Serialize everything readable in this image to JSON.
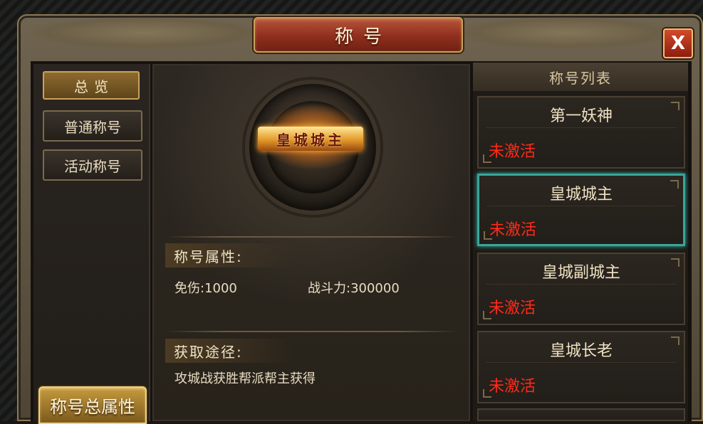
{
  "window": {
    "title": "称号",
    "close_label": "X"
  },
  "nav": {
    "items": [
      {
        "label": "总览",
        "active": true
      },
      {
        "label": "普通称号",
        "active": false
      },
      {
        "label": "活动称号",
        "active": false
      }
    ],
    "total_button": "称号总属性"
  },
  "detail": {
    "emblem_text": "皇城城主",
    "attributes_heading": "称号属性:",
    "attributes": [
      {
        "label": "免伤:",
        "value": "1000"
      },
      {
        "label": "战斗力:",
        "value": "300000"
      }
    ],
    "source_heading": "获取途径:",
    "source_text": "攻城战获胜帮派帮主获得"
  },
  "title_list": {
    "heading": "称号列表",
    "items": [
      {
        "name": "第一妖神",
        "status": "未激活",
        "selected": false
      },
      {
        "name": "皇城城主",
        "status": "未激活",
        "selected": true
      },
      {
        "name": "皇城副城主",
        "status": "未激活",
        "selected": false
      },
      {
        "name": "皇城长老",
        "status": "未激活",
        "selected": false
      }
    ]
  },
  "colors": {
    "status_inactive": "#ff2a1a",
    "selection_border": "#3aa59a",
    "title_plate": "#9b3a24"
  }
}
